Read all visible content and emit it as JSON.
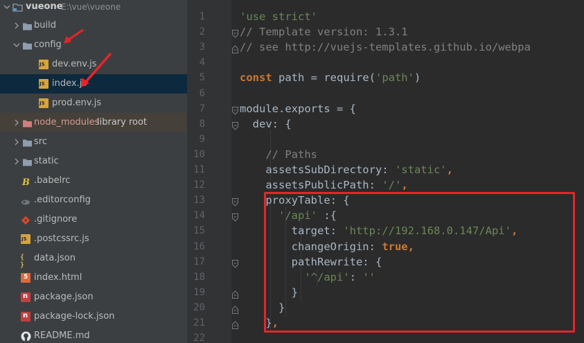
{
  "project": {
    "name": "vueone",
    "path": "E:\\vue\\vueone"
  },
  "tree": {
    "items": [
      {
        "label": "build",
        "type": "folder",
        "depth": 1,
        "expanded": false
      },
      {
        "label": "config",
        "type": "folder",
        "depth": 1,
        "expanded": true
      },
      {
        "label": "dev.env.js",
        "type": "js",
        "depth": 2
      },
      {
        "label": "index.js",
        "type": "js",
        "depth": 2,
        "selected": true
      },
      {
        "label": "prod.env.js",
        "type": "js",
        "depth": 2
      },
      {
        "label": "node_modules",
        "type": "folder-excluded",
        "depth": 1,
        "expanded": false,
        "extra": "library root"
      },
      {
        "label": "src",
        "type": "folder",
        "depth": 1,
        "expanded": false
      },
      {
        "label": "static",
        "type": "folder",
        "depth": 1,
        "expanded": false
      },
      {
        "label": ".babelrc",
        "type": "babel",
        "depth": 1
      },
      {
        "label": ".editorconfig",
        "type": "config",
        "depth": 1
      },
      {
        "label": ".gitignore",
        "type": "git",
        "depth": 1
      },
      {
        "label": ".postcssrc.js",
        "type": "js",
        "depth": 1
      },
      {
        "label": "data.json",
        "type": "json",
        "depth": 1
      },
      {
        "label": "index.html",
        "type": "html",
        "depth": 1
      },
      {
        "label": "package.json",
        "type": "npm",
        "depth": 1
      },
      {
        "label": "package-lock.json",
        "type": "npm",
        "depth": 1
      },
      {
        "label": "README.md",
        "type": "github",
        "depth": 1
      }
    ]
  },
  "editor": {
    "lines": [
      {
        "n": "1",
        "tokens": [
          {
            "t": "'use strict'",
            "c": "str"
          }
        ]
      },
      {
        "n": "2",
        "tokens": [
          {
            "t": "// Template version: 1.3.1",
            "c": "cmt"
          }
        ]
      },
      {
        "n": "3",
        "tokens": [
          {
            "t": "// see http://vuejs-templates.github.io/webpa",
            "c": "cmt"
          }
        ]
      },
      {
        "n": "4",
        "tokens": []
      },
      {
        "n": "5",
        "tokens": [
          {
            "t": "const",
            "c": "kw"
          },
          {
            "t": " path = require(",
            "c": "pn"
          },
          {
            "t": "'path'",
            "c": "str"
          },
          {
            "t": ")",
            "c": "pn"
          }
        ]
      },
      {
        "n": "6",
        "tokens": []
      },
      {
        "n": "7",
        "tokens": [
          {
            "t": "module.exports = {",
            "c": "pn"
          }
        ]
      },
      {
        "n": "8",
        "tokens": [
          {
            "t": "  dev: {",
            "c": "pn"
          }
        ]
      },
      {
        "n": "9",
        "tokens": []
      },
      {
        "n": "10",
        "tokens": [
          {
            "t": "    ",
            "c": "pn"
          },
          {
            "t": "// Paths",
            "c": "cmt"
          }
        ]
      },
      {
        "n": "11",
        "tokens": [
          {
            "t": "    assetsSubDirectory: ",
            "c": "pn"
          },
          {
            "t": "'static'",
            "c": "str"
          },
          {
            "t": ",",
            "c": "kw"
          }
        ]
      },
      {
        "n": "12",
        "tokens": [
          {
            "t": "    assetsPublicPath: ",
            "c": "pn"
          },
          {
            "t": "'/'",
            "c": "str"
          },
          {
            "t": ",",
            "c": "kw"
          }
        ]
      },
      {
        "n": "13",
        "tokens": [
          {
            "t": "    proxyTable: {",
            "c": "pn"
          }
        ]
      },
      {
        "n": "14",
        "tokens": [
          {
            "t": "      ",
            "c": "pn"
          },
          {
            "t": "'/api'",
            "c": "str"
          },
          {
            "t": " :{",
            "c": "pn"
          }
        ]
      },
      {
        "n": "15",
        "tokens": [
          {
            "t": "        target: ",
            "c": "pn"
          },
          {
            "t": "'http://192.168.0.147/Api'",
            "c": "str"
          },
          {
            "t": ",",
            "c": "kw"
          }
        ]
      },
      {
        "n": "16",
        "tokens": [
          {
            "t": "        changeOrigin: ",
            "c": "pn"
          },
          {
            "t": "true",
            "c": "kw"
          },
          {
            "t": ",",
            "c": "kw"
          }
        ]
      },
      {
        "n": "17",
        "tokens": [
          {
            "t": "        pathRewrite: {",
            "c": "pn"
          }
        ]
      },
      {
        "n": "18",
        "tokens": [
          {
            "t": "          ",
            "c": "pn"
          },
          {
            "t": "'^/api'",
            "c": "str"
          },
          {
            "t": ": ",
            "c": "pn"
          },
          {
            "t": "''",
            "c": "str"
          }
        ]
      },
      {
        "n": "19",
        "tokens": [
          {
            "t": "        }",
            "c": "pn"
          }
        ]
      },
      {
        "n": "20",
        "tokens": [
          {
            "t": "      }",
            "c": "pn"
          }
        ]
      },
      {
        "n": "21",
        "tokens": [
          {
            "t": "    }",
            "c": "pn"
          },
          {
            "t": ",",
            "c": "kw"
          }
        ]
      },
      {
        "n": "22",
        "tokens": []
      }
    ]
  },
  "colors": {
    "annotation": "#e8242a",
    "folder": "#8f9db0",
    "excluded_folder": "#d07e7e",
    "excluded_label": "#d99a95",
    "excluded_extra": "#c8c8c8"
  }
}
